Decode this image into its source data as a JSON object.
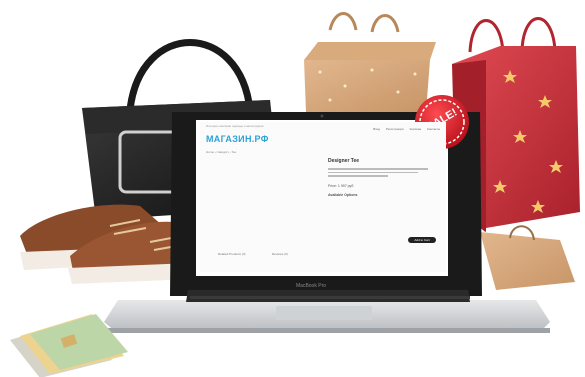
{
  "badge": {
    "text": "SALE!"
  },
  "shop": {
    "logo": "МАГАЗИН.РФ",
    "top_note": "Интернет-магазин одежды и аксессуаров",
    "nav": [
      "Вход",
      "Регистрация",
      "Корзина",
      "Контакты"
    ],
    "breadcrumb": "Home › Category › Tee",
    "product_title": "Designer Tee",
    "price": "Price: 1 997 руб",
    "options_label": "Available Options",
    "cart_button": "Add to Cart",
    "tabs": [
      "Related Products (3)",
      "Reviews (0)"
    ]
  },
  "laptop": {
    "brand_label": "MacBook Pro"
  },
  "colors": {
    "accent": "#2aa3d8",
    "sale": "#d91c24",
    "bag_red": "#c8323c"
  }
}
